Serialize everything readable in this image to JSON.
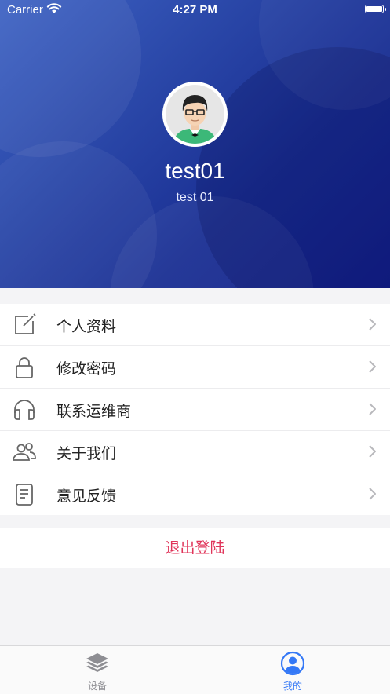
{
  "status_bar": {
    "carrier": "Carrier",
    "time": "4:27 PM"
  },
  "profile": {
    "name": "test01",
    "account": "test 01"
  },
  "menu": {
    "items": [
      {
        "label": "个人资料",
        "icon": "edit-icon"
      },
      {
        "label": "修改密码",
        "icon": "lock-icon"
      },
      {
        "label": "联系运维商",
        "icon": "headphones-icon"
      },
      {
        "label": "关于我们",
        "icon": "users-icon"
      },
      {
        "label": "意见反馈",
        "icon": "document-icon"
      }
    ]
  },
  "logout": {
    "label": "退出登陆"
  },
  "tabbar": {
    "tabs": [
      {
        "label": "设备",
        "icon": "layers-icon",
        "active": false
      },
      {
        "label": "我的",
        "icon": "profile-icon",
        "active": true
      }
    ]
  },
  "colors": {
    "accent": "#3478f6",
    "logout": "#e0355a",
    "header_dark": "#13208a",
    "header_light": "#3e63c4"
  }
}
